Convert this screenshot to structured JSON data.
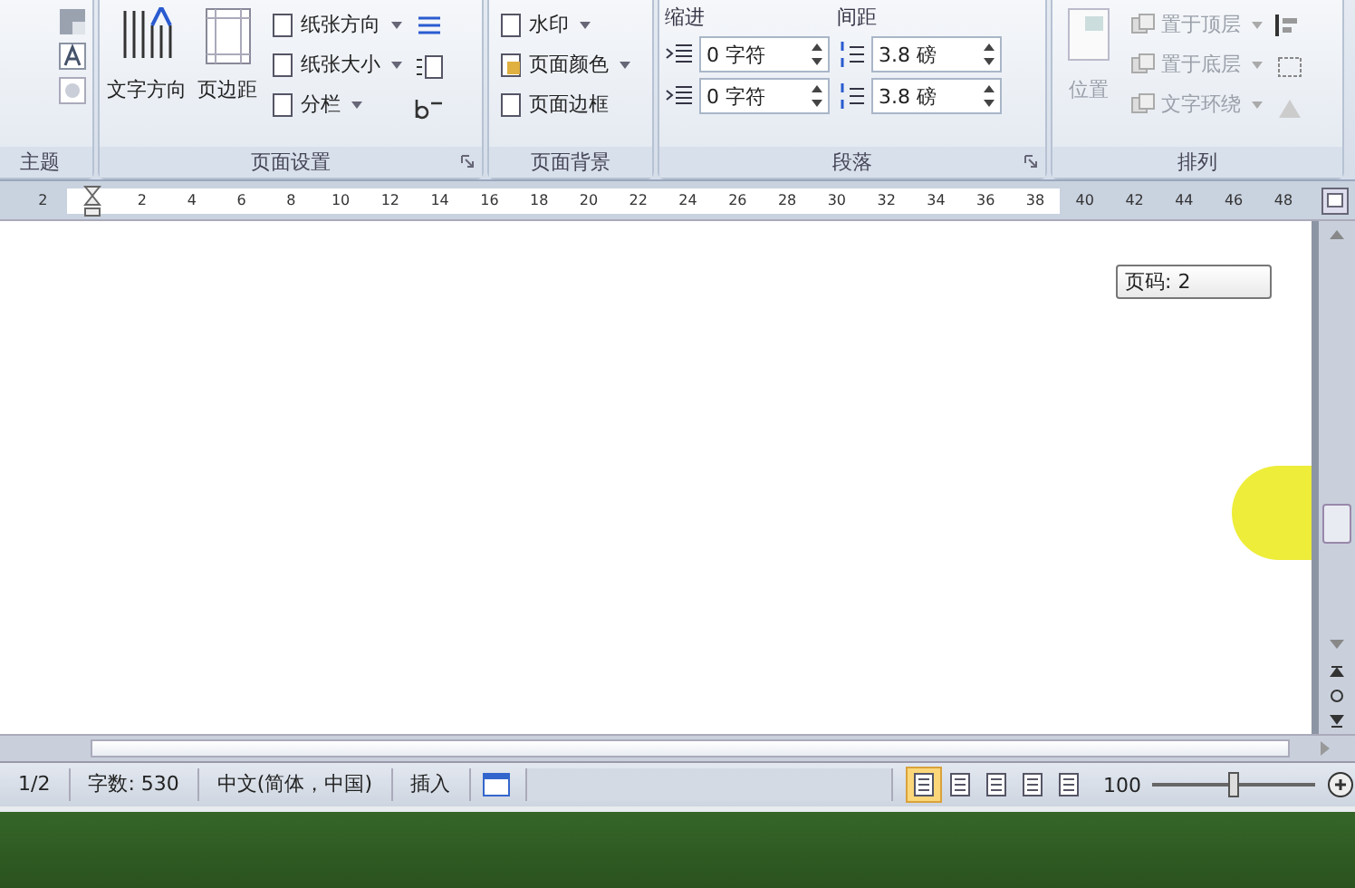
{
  "ribbon": {
    "groups": [
      {
        "kind": "themes",
        "label": "主题"
      },
      {
        "kind": "page_setup",
        "label": "页面设置",
        "large_buttons": [
          "文字方向",
          "页边距"
        ],
        "small_buttons": [
          "纸张方向",
          "纸张大小",
          "分栏"
        ]
      },
      {
        "kind": "background",
        "label": "页面背景",
        "small_buttons": [
          "水印",
          "页面颜色",
          "页面边框"
        ]
      },
      {
        "kind": "paragraph",
        "label": "段落",
        "indent_label": "缩进",
        "spacing_label": "间距",
        "indent_fields": [
          "0 字符",
          "0 字符"
        ],
        "spacing_fields": [
          "3.8 磅",
          "3.8 磅"
        ]
      },
      {
        "kind": "arrange",
        "label": "排列",
        "disabled": true,
        "large_buttons": [
          "位置"
        ],
        "small_buttons": [
          "置于顶层",
          "置于底层",
          "文字环绕"
        ]
      }
    ]
  },
  "ruler": {
    "ticks": [
      "2",
      "2",
      "4",
      "6",
      "8",
      "10",
      "12",
      "14",
      "16",
      "18",
      "20",
      "22",
      "24",
      "26",
      "28",
      "30",
      "32",
      "34",
      "36",
      "38",
      "40",
      "42",
      "44",
      "46",
      "48"
    ]
  },
  "page_tooltip": "页码: 2",
  "status_bar": {
    "items": [
      "1/2",
      "字数: 530",
      "中文(简体，中国)",
      "插入"
    ],
    "views": [
      {
        "selected": true
      },
      {
        "selected": false
      },
      {
        "selected": false
      },
      {
        "selected": false
      },
      {
        "selected": false
      }
    ],
    "zoom": "100",
    "zoom_slider": {
      "level": 0.5
    }
  }
}
